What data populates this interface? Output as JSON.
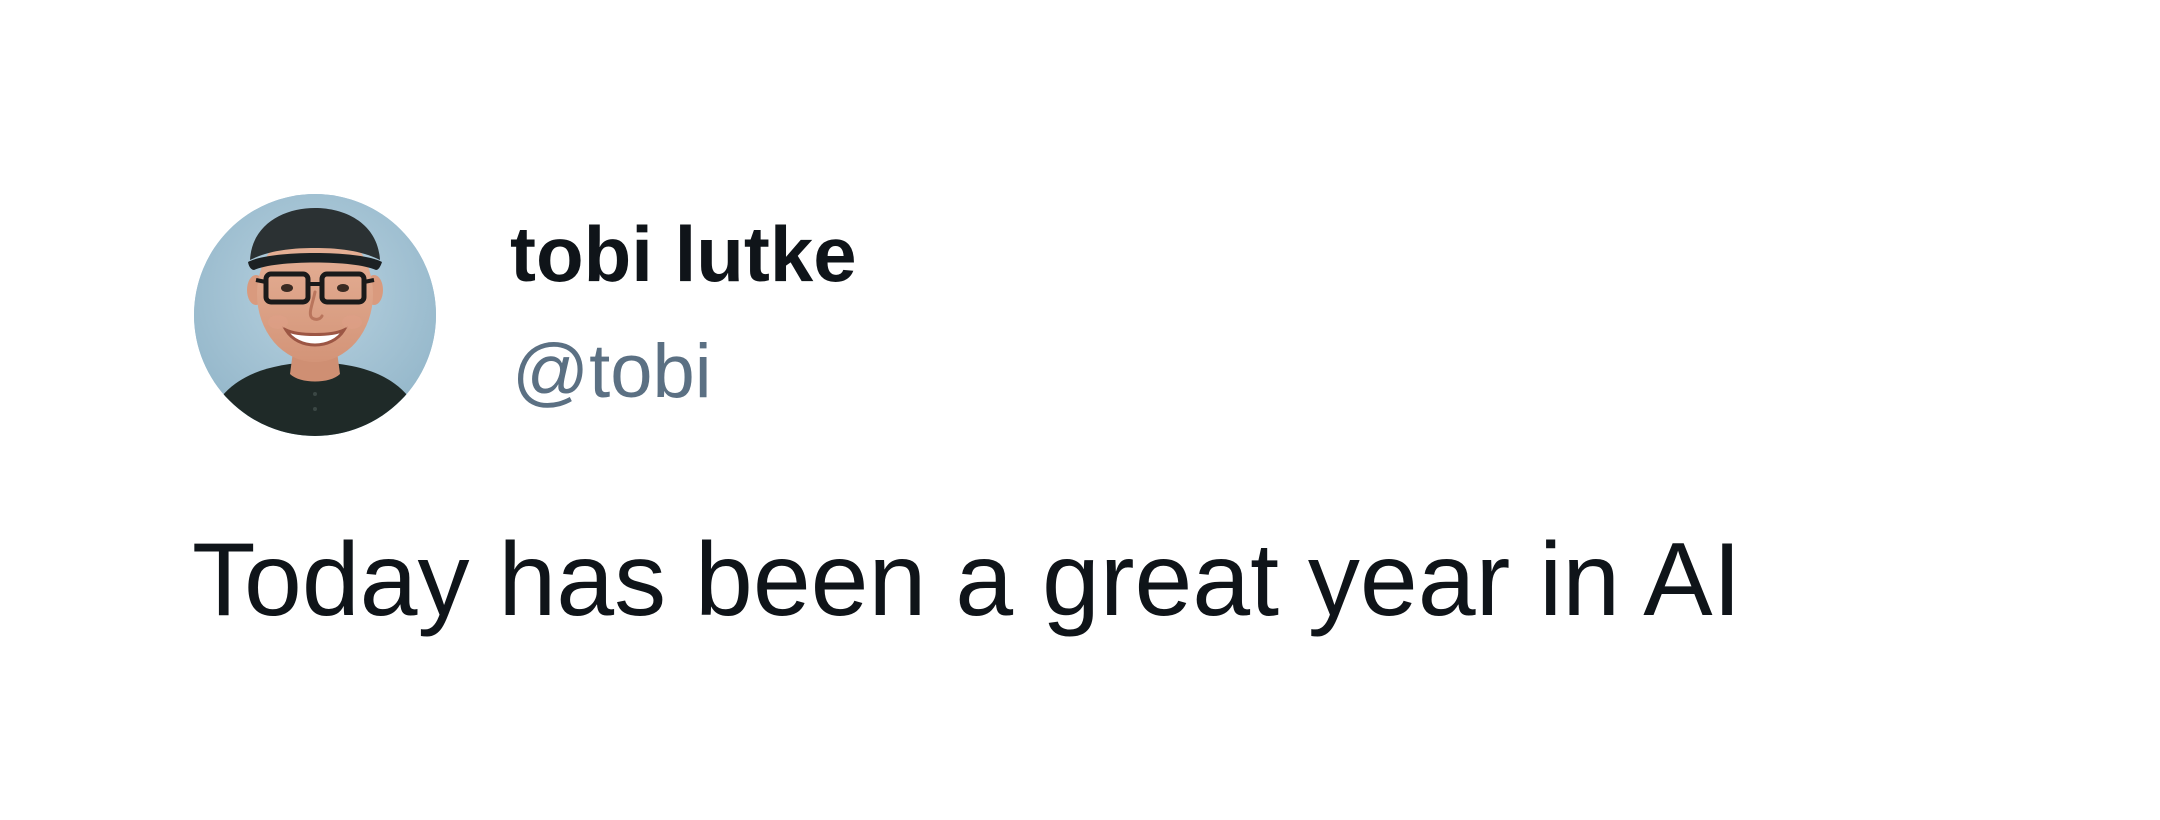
{
  "tweet": {
    "author_name": "tobi lutke",
    "author_handle": "@tobi",
    "text": "Today has been a great year in AI"
  },
  "colors": {
    "background": "#ffffff",
    "name_text": "#0f1419",
    "handle_text": "#5b7083",
    "body_text": "#0f1419",
    "avatar_background": "#a7c5d6"
  }
}
